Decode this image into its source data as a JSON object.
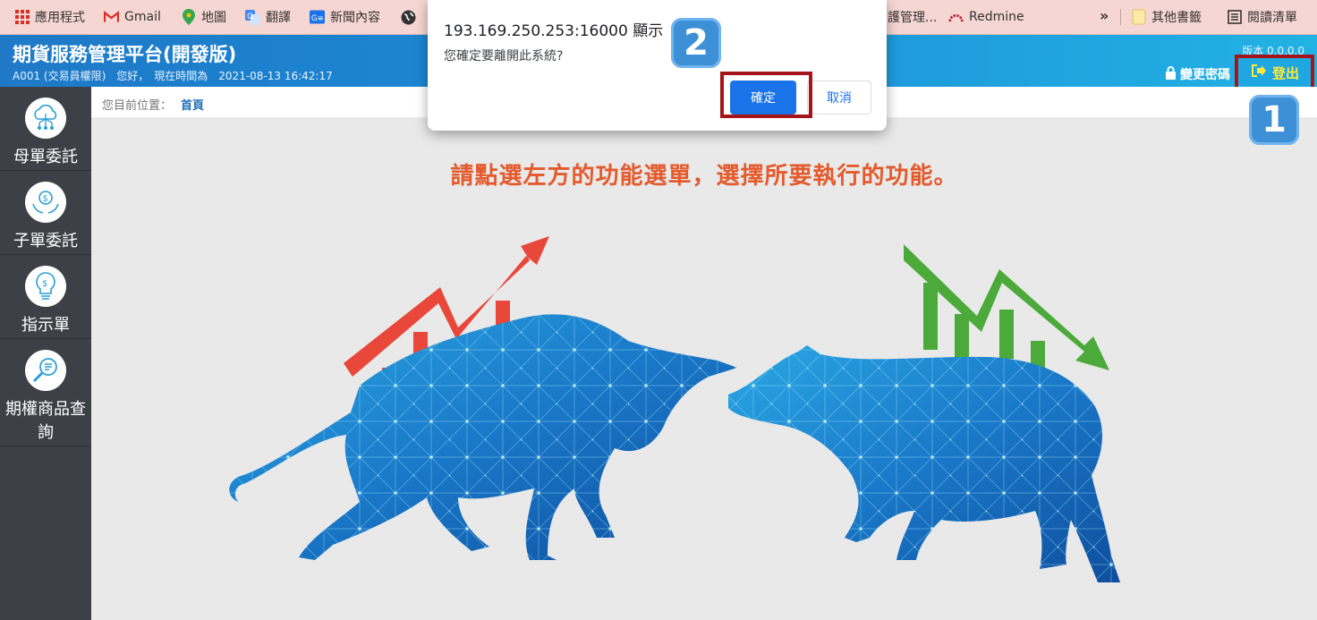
{
  "bookmarks": {
    "items": [
      "應用程式",
      "Gmail",
      "地圖",
      "翻譯",
      "新聞內容",
      "護管理...",
      "Redmine"
    ],
    "more": "»",
    "other": "其他書籤",
    "reading": "閱讀清單"
  },
  "header": {
    "title": "期貨服務管理平台(開發版)",
    "user_info": "A001 (交易員權限)　您好，　現在時間為　2021-08-13 16:42:17",
    "version": "版本 0.0.0.0",
    "change_password": "變更密碼",
    "logout": "登出"
  },
  "sidebar": {
    "items": [
      {
        "label": "母單委託",
        "icon": "cloud-network-icon"
      },
      {
        "label": "子單委託",
        "icon": "money-hands-icon"
      },
      {
        "label": "指示單",
        "icon": "lightbulb-dollar-icon"
      },
      {
        "label": "期權商品查詢",
        "icon": "search-doc-icon"
      }
    ]
  },
  "breadcrumb": {
    "prefix": "您目前位置：",
    "current": "首頁"
  },
  "main": {
    "headline": "請點選左方的功能選單，選擇所要執行的功能。"
  },
  "dialog": {
    "origin": "193.169.250.253:16000 顯示",
    "message": "您確定要離開此系統?",
    "ok": "確定",
    "cancel": "取消"
  },
  "annotations": {
    "step1": "1",
    "step2": "2"
  },
  "colors": {
    "header_start": "#1f79c7",
    "header_end": "#22b2e4",
    "sidebar": "#3d4147",
    "headline": "#e45a2c",
    "highlight": "#a4141a",
    "bull_arrow": "#e8473a",
    "bear_arrow": "#4caa3a",
    "animal_blue": "#1f8fd6"
  }
}
